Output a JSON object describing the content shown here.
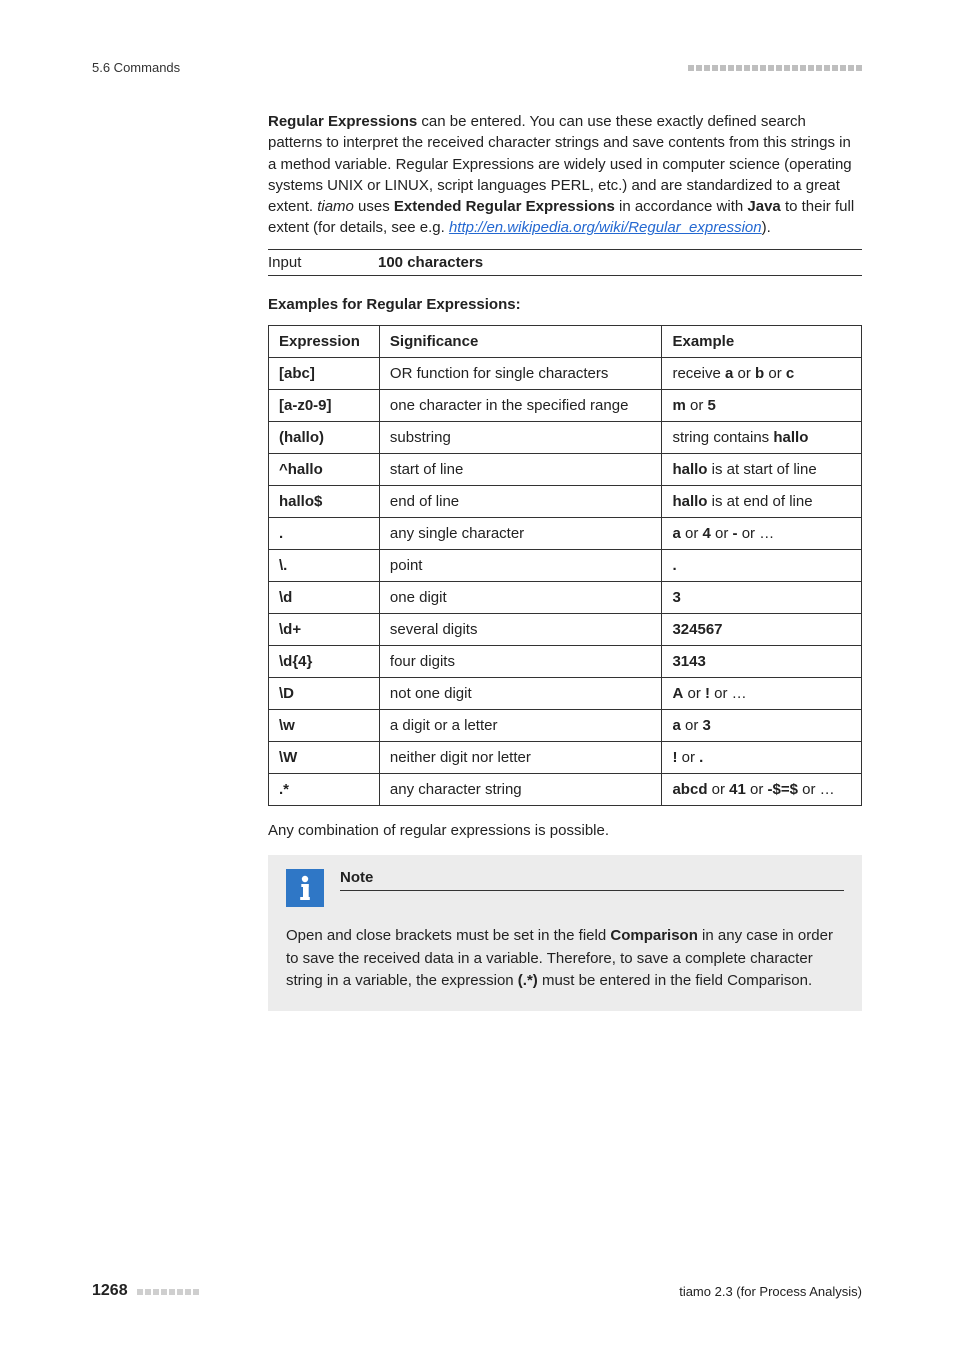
{
  "header": {
    "section": "5.6 Commands",
    "deco_count": 22
  },
  "intro": {
    "t1_a": "Regular Expressions",
    "t1_b": " can be entered. You can use these exactly defined search patterns to interpret the received character strings and save contents from this strings in a method variable. Regular Expressions are widely used in computer science (operating systems UNIX or LINUX, script languages PERL, etc.) and are standardized to a great extent. ",
    "t1_c": "tiamo",
    "t1_d": " uses ",
    "t1_e": "Extended Regular Expressions",
    "t1_f": " in accordance with ",
    "t1_g": "Java",
    "t1_h": " to their full extent (for details, see e.g. ",
    "t1_link": "http://en.wikipedia.org/wiki/Regular_expression",
    "t1_i": ")."
  },
  "input_row": {
    "label": "Input",
    "value": "100 characters"
  },
  "examples_heading": "Examples for Regular Expressions:",
  "table": {
    "h1": "Expression",
    "h2": "Significance",
    "h3": "Example",
    "rows": [
      {
        "expr": "[abc]",
        "sig": "OR function for single characters",
        "ex": [
          {
            "t": "receive "
          },
          {
            "t": "a",
            "b": true
          },
          {
            "t": " or "
          },
          {
            "t": "b",
            "b": true
          },
          {
            "t": " or "
          },
          {
            "t": "c",
            "b": true
          }
        ]
      },
      {
        "expr": "[a-z0-9]",
        "sig": "one character in the specified range",
        "ex": [
          {
            "t": "m",
            "b": true
          },
          {
            "t": " or "
          },
          {
            "t": "5",
            "b": true
          }
        ]
      },
      {
        "expr": "(hallo)",
        "sig": "substring",
        "ex": [
          {
            "t": "string contains "
          },
          {
            "t": "hallo",
            "b": true
          }
        ]
      },
      {
        "expr": "^hallo",
        "sig": "start of line",
        "ex": [
          {
            "t": "hallo",
            "b": true
          },
          {
            "t": " is at start of line"
          }
        ]
      },
      {
        "expr": "hallo$",
        "sig": "end of line",
        "ex": [
          {
            "t": "hallo",
            "b": true
          },
          {
            "t": " is at end of line"
          }
        ]
      },
      {
        "expr": ".",
        "sig": "any single character",
        "ex": [
          {
            "t": "a",
            "b": true
          },
          {
            "t": " or "
          },
          {
            "t": "4",
            "b": true
          },
          {
            "t": " or "
          },
          {
            "t": "-",
            "b": true
          },
          {
            "t": " or …"
          }
        ]
      },
      {
        "expr": "\\.",
        "sig": "point",
        "ex": [
          {
            "t": ".",
            "b": true
          }
        ]
      },
      {
        "expr": "\\d",
        "sig": "one digit",
        "ex": [
          {
            "t": "3",
            "b": true
          }
        ]
      },
      {
        "expr": "\\d+",
        "sig": "several digits",
        "ex": [
          {
            "t": "324567",
            "b": true
          }
        ]
      },
      {
        "expr": "\\d{4}",
        "sig": "four digits",
        "ex": [
          {
            "t": "3143",
            "b": true
          }
        ]
      },
      {
        "expr": "\\D",
        "sig": "not one digit",
        "ex": [
          {
            "t": "A",
            "b": true
          },
          {
            "t": " or "
          },
          {
            "t": "!",
            "b": true
          },
          {
            "t": " or …"
          }
        ]
      },
      {
        "expr": "\\w",
        "sig": "a digit or a letter",
        "ex": [
          {
            "t": "a",
            "b": true
          },
          {
            "t": " or "
          },
          {
            "t": "3",
            "b": true
          }
        ]
      },
      {
        "expr": "\\W",
        "sig": "neither digit nor letter",
        "ex": [
          {
            "t": "!",
            "b": true
          },
          {
            "t": " or "
          },
          {
            "t": ".",
            "b": true
          }
        ]
      },
      {
        "expr": ".*",
        "sig": "any character string",
        "ex": [
          {
            "t": "abcd",
            "b": true
          },
          {
            "t": " or "
          },
          {
            "t": "41",
            "b": true
          },
          {
            "t": " or "
          },
          {
            "t": "-$=$",
            "b": true
          },
          {
            "t": " or …"
          }
        ]
      }
    ]
  },
  "after_table": "Any combination of regular expressions is possible.",
  "note": {
    "title": "Note",
    "b1": "Open and close brackets must be set in the field ",
    "b2": "Comparison",
    "b3": " in any case in order to save the received data in a variable. Therefore, to save a complete character string in a variable, the expression ",
    "b4": "(.*)",
    "b5": " must be entered in the field Comparison."
  },
  "footer": {
    "page": "1268",
    "deco_count": 8,
    "product": "tiamo 2.3 (for Process Analysis)"
  }
}
